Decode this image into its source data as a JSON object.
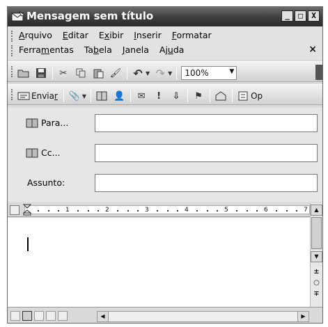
{
  "window": {
    "title": "Mensagem sem título"
  },
  "window_controls": {
    "minimize": "_",
    "restore": "□",
    "close": "X"
  },
  "menu": {
    "row1": [
      {
        "pre": "",
        "acc": "A",
        "post": "rquivo"
      },
      {
        "pre": "",
        "acc": "E",
        "post": "ditar"
      },
      {
        "pre": "E",
        "acc": "x",
        "post": "ibir"
      },
      {
        "pre": "",
        "acc": "I",
        "post": "nserir"
      },
      {
        "pre": "",
        "acc": "F",
        "post": "ormatar"
      }
    ],
    "row2": [
      {
        "pre": "Ferra",
        "acc": "m",
        "post": "entas"
      },
      {
        "pre": "Ta",
        "acc": "b",
        "post": "ela"
      },
      {
        "pre": "",
        "acc": "J",
        "post": "anela"
      },
      {
        "pre": "Aj",
        "acc": "u",
        "post": "da"
      }
    ],
    "close_doc": "×"
  },
  "toolbar_standard": {
    "zoom": "100%"
  },
  "toolbar_email": {
    "send_pre": "Envia",
    "send_acc": "r",
    "overflow_label": "Op"
  },
  "address": {
    "to_label": "Para...",
    "cc_label": "Cc...",
    "subject_label": "Assunto:",
    "to_value": "",
    "cc_value": "",
    "subject_value": ""
  },
  "ruler": {
    "numbers": [
      "1",
      "2",
      "3",
      "4",
      "5",
      "6",
      "7"
    ]
  },
  "document": {
    "body_text": ""
  }
}
